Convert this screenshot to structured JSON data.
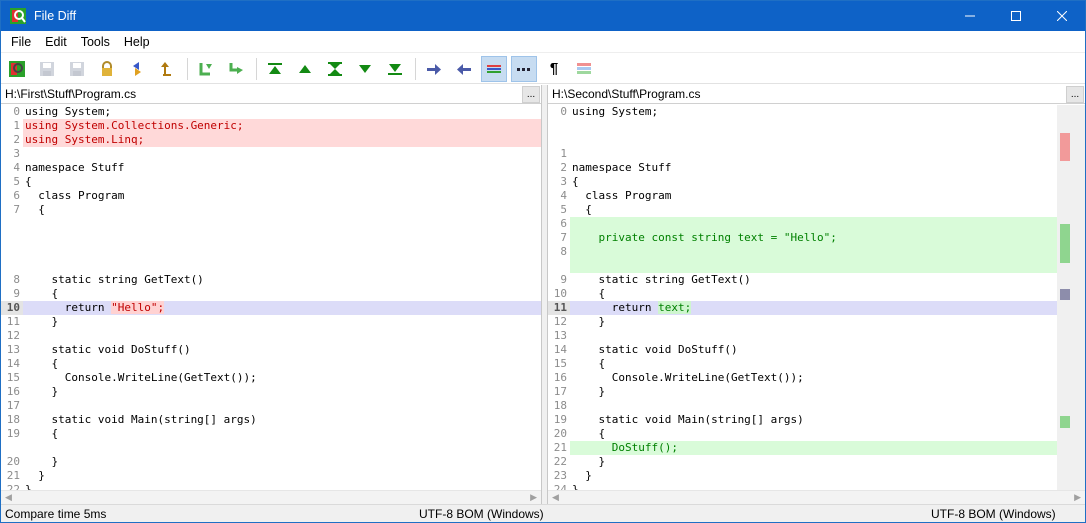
{
  "window": {
    "title": "File Diff"
  },
  "menu": [
    "File",
    "Edit",
    "Tools",
    "Help"
  ],
  "toolbar": {
    "buttons": [
      {
        "name": "compare-icon"
      },
      {
        "name": "save-icon"
      },
      {
        "name": "save-all-icon"
      },
      {
        "name": "lock-icon"
      },
      {
        "name": "swap-icon"
      },
      {
        "name": "up-folder-icon"
      },
      {
        "name": "copy-left-icon"
      },
      {
        "name": "copy-right-icon"
      },
      {
        "name": "first-diff-icon"
      },
      {
        "name": "prev-diff-icon"
      },
      {
        "name": "current-diff-icon"
      },
      {
        "name": "next-diff-icon"
      },
      {
        "name": "last-diff-icon"
      },
      {
        "name": "goto-right-icon"
      },
      {
        "name": "goto-left-icon"
      },
      {
        "name": "show-lines-icon"
      },
      {
        "name": "show-dashes-icon"
      },
      {
        "name": "pilcrow-icon"
      },
      {
        "name": "overview-icon"
      }
    ],
    "pilcrow": "¶"
  },
  "left": {
    "path": "H:\\First\\Stuff\\Program.cs",
    "browse_label": "...",
    "lines": [
      {
        "num": "0",
        "text": "using System;",
        "kind": ""
      },
      {
        "num": "1",
        "text": "using System.Collections.Generic;",
        "kind": "removed"
      },
      {
        "num": "2",
        "text": "using System.Linq;",
        "kind": "removed"
      },
      {
        "num": "3",
        "text": "",
        "kind": ""
      },
      {
        "num": "4",
        "text": "namespace Stuff",
        "kind": ""
      },
      {
        "num": "5",
        "text": "{",
        "kind": ""
      },
      {
        "num": "6",
        "text": "  class Program",
        "kind": ""
      },
      {
        "num": "7",
        "text": "  {",
        "kind": ""
      },
      {
        "num": "",
        "text": "",
        "kind": "pad"
      },
      {
        "num": "",
        "text": "",
        "kind": "pad"
      },
      {
        "num": "",
        "text": "",
        "kind": "pad"
      },
      {
        "num": "",
        "text": "",
        "kind": "pad"
      },
      {
        "num": "8",
        "text": "    static string GetText()",
        "kind": ""
      },
      {
        "num": "9",
        "text": "    {",
        "kind": ""
      },
      {
        "num": "10",
        "text": "      return ",
        "hl": "\"Hello\";",
        "kind": "current"
      },
      {
        "num": "11",
        "text": "    }",
        "kind": ""
      },
      {
        "num": "12",
        "text": "",
        "kind": ""
      },
      {
        "num": "13",
        "text": "    static void DoStuff()",
        "kind": ""
      },
      {
        "num": "14",
        "text": "    {",
        "kind": ""
      },
      {
        "num": "15",
        "text": "      Console.WriteLine(GetText());",
        "kind": ""
      },
      {
        "num": "16",
        "text": "    }",
        "kind": ""
      },
      {
        "num": "17",
        "text": "",
        "kind": ""
      },
      {
        "num": "18",
        "text": "    static void Main(string[] args)",
        "kind": ""
      },
      {
        "num": "19",
        "text": "    {",
        "kind": ""
      },
      {
        "num": "",
        "text": "",
        "kind": "pad"
      },
      {
        "num": "20",
        "text": "    }",
        "kind": ""
      },
      {
        "num": "21",
        "text": "  }",
        "kind": ""
      },
      {
        "num": "22",
        "text": "}",
        "kind": ""
      }
    ]
  },
  "right": {
    "path": "H:\\Second\\Stuff\\Program.cs",
    "browse_label": "...",
    "lines": [
      {
        "num": "0",
        "text": "using System;",
        "kind": ""
      },
      {
        "num": "",
        "text": "",
        "kind": "pad"
      },
      {
        "num": "",
        "text": "",
        "kind": "pad"
      },
      {
        "num": "1",
        "text": "",
        "kind": ""
      },
      {
        "num": "2",
        "text": "namespace Stuff",
        "kind": ""
      },
      {
        "num": "3",
        "text": "{",
        "kind": ""
      },
      {
        "num": "4",
        "text": "  class Program",
        "kind": ""
      },
      {
        "num": "5",
        "text": "  {",
        "kind": ""
      },
      {
        "num": "6",
        "text": "",
        "kind": "added"
      },
      {
        "num": "7",
        "text": "    private const string text = \"Hello\";",
        "kind": "added"
      },
      {
        "num": "8",
        "text": "",
        "kind": "added"
      },
      {
        "num": "",
        "text": "",
        "kind": "added-pad"
      },
      {
        "num": "9",
        "text": "    static string GetText()",
        "kind": ""
      },
      {
        "num": "10",
        "text": "    {",
        "kind": ""
      },
      {
        "num": "11",
        "text": "      return ",
        "hl": "text;",
        "kind": "current"
      },
      {
        "num": "12",
        "text": "    }",
        "kind": ""
      },
      {
        "num": "13",
        "text": "",
        "kind": ""
      },
      {
        "num": "14",
        "text": "    static void DoStuff()",
        "kind": ""
      },
      {
        "num": "15",
        "text": "    {",
        "kind": ""
      },
      {
        "num": "16",
        "text": "      Console.WriteLine(GetText());",
        "kind": ""
      },
      {
        "num": "17",
        "text": "    }",
        "kind": ""
      },
      {
        "num": "18",
        "text": "",
        "kind": ""
      },
      {
        "num": "19",
        "text": "    static void Main(string[] args)",
        "kind": ""
      },
      {
        "num": "20",
        "text": "    {",
        "kind": ""
      },
      {
        "num": "21",
        "text": "      DoStuff();",
        "kind": "added"
      },
      {
        "num": "22",
        "text": "    }",
        "kind": ""
      },
      {
        "num": "23",
        "text": "  }",
        "kind": ""
      },
      {
        "num": "24",
        "text": "}",
        "kind": ""
      }
    ]
  },
  "status": {
    "compare_time": "Compare time 5ms",
    "left_encoding": "UTF-8 BOM (Windows)",
    "right_encoding": "UTF-8 BOM (Windows)"
  },
  "colors": {
    "titlebar": "#0e62c7",
    "removed": "#ffd9d9",
    "added": "#d9fbd9",
    "current": "#dcdcf8"
  }
}
